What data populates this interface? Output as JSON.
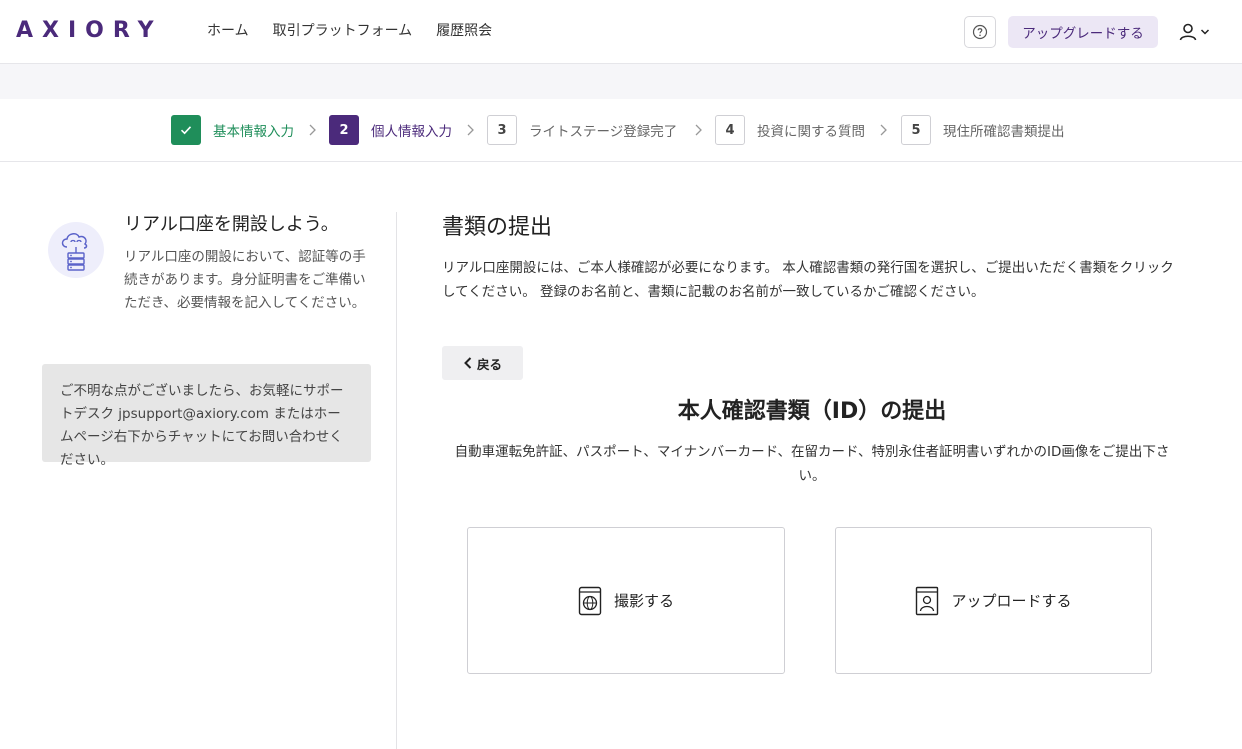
{
  "header": {
    "logo": "AXIORY",
    "nav": [
      "ホーム",
      "取引プラットフォーム",
      "履歴照会"
    ],
    "upgrade_label": "アップグレードする",
    "icons": {
      "help": "help-circle-icon",
      "user": "user-icon",
      "chevron": "chevron-down-icon"
    }
  },
  "stepper": {
    "steps": [
      {
        "number": "✓",
        "label": "基本情報入力",
        "state": "done"
      },
      {
        "number": "2",
        "label": "個人情報入力",
        "state": "active"
      },
      {
        "number": "3",
        "label": "ライトステージ登録完了",
        "state": "pending"
      },
      {
        "number": "4",
        "label": "投資に関する質問",
        "state": "pending"
      },
      {
        "number": "5",
        "label": "現住所確認書類提出",
        "state": "pending"
      }
    ]
  },
  "sidebar": {
    "title": "リアル口座を開設しよう。",
    "text": "リアル口座の開設において、認証等の手続きがあります。身分証明書をご準備いただき、必要情報を記入してください。",
    "support": "ご不明な点がございましたら、お気軽にサポートデスク jpsupport@axiory.com またはホームページ右下からチャットにてお問い合わせください。"
  },
  "main": {
    "title": "書類の提出",
    "description": "リアル口座開設には、ご本人様確認が必要になります。 本人確認書類の発行国を選択し、ご提出いただく書類をクリックしてください。 登録のお名前と、書類に記載のお名前が一致しているかご確認ください。",
    "back_label": "戻る",
    "id_title": "本人確認書類（ID）の提出",
    "id_description": "自動車運転免許証、パスポート、マイナンバーカード、在留カード、特別永住者証明書いずれかのID画像をご提出下さい。",
    "camera_label": "撮影する",
    "upload_label": "アップロードする"
  },
  "colors": {
    "brand": "#4b2a7b",
    "success": "#1f8e5a",
    "upgrade_bg": "#ece7f5"
  }
}
